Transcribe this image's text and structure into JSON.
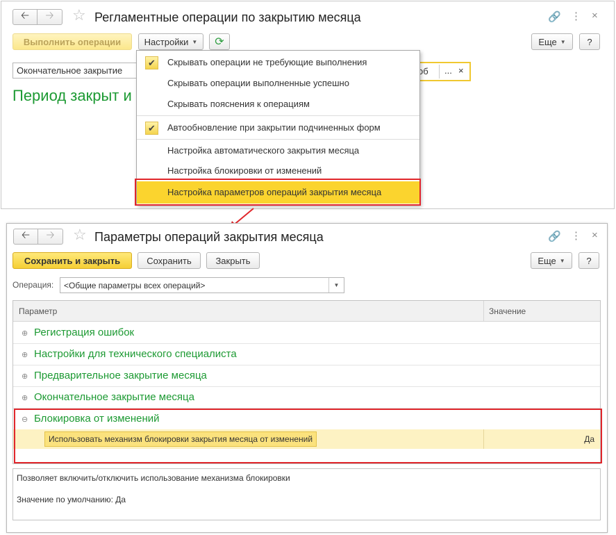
{
  "window1": {
    "title": "Регламентные операции по закрытию месяца",
    "run_button": "Выполнить операции",
    "settings_button": "Настройки",
    "more_button": "Еще",
    "help_button": "?",
    "period_field": "Окончательное закрытие",
    "org_field_fragment": "об",
    "org_field_dots": "...",
    "org_field_clear": "×",
    "period_status": "Период закрыт и"
  },
  "menu": {
    "items": [
      {
        "label": "Скрывать операции не требующие выполнения",
        "checked": true
      },
      {
        "label": "Скрывать операции выполненные успешно",
        "checked": false
      },
      {
        "label": "Скрывать пояснения к операциям",
        "checked": false
      },
      {
        "label": "Автообновление при закрытии подчиненных форм",
        "checked": true
      },
      {
        "label": "Настройка автоматического закрытия месяца",
        "checked": false
      },
      {
        "label": "Настройка блокировки от изменений",
        "checked": false
      },
      {
        "label": "Настройка параметров операций закрытия месяца",
        "checked": false,
        "highlighted": true
      }
    ]
  },
  "window2": {
    "title": "Параметры операций закрытия месяца",
    "save_close_button": "Сохранить и закрыть",
    "save_button": "Сохранить",
    "close_button": "Закрыть",
    "more_button": "Еще",
    "help_button": "?",
    "operation_label": "Операция:",
    "operation_value": "<Общие параметры всех операций>",
    "table": {
      "columns": [
        "Параметр",
        "Значение"
      ],
      "groups": [
        {
          "label": "Регистрация ошибок",
          "expanded": false
        },
        {
          "label": "Настройки для технического специалиста",
          "expanded": false
        },
        {
          "label": "Предварительное закрытие месяца",
          "expanded": false
        },
        {
          "label": "Окончательное закрытие месяца",
          "expanded": false
        },
        {
          "label": "Блокировка от изменений",
          "expanded": true
        }
      ],
      "selected_row": {
        "param": "Использовать механизм блокировки закрытия месяца от изменений",
        "value": "Да"
      }
    },
    "description": {
      "line1": "Позволяет включить/отключить использование механизма блокировки",
      "line2": "Значение по умолчанию: Да"
    }
  },
  "colors": {
    "accent_yellow": "#f5cf35",
    "highlight_red": "#e0262b",
    "green_text": "#1d9a33"
  }
}
